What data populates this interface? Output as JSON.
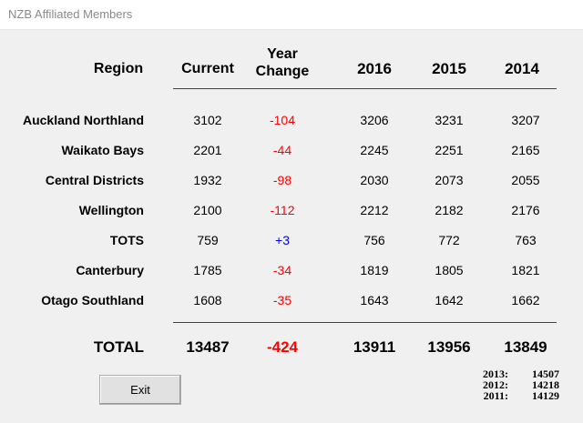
{
  "window": {
    "title": "NZB Affiliated Members"
  },
  "headers": {
    "region": "Region",
    "current": "Current",
    "year_change_line1": "Year",
    "year_change_line2": "Change",
    "y2016": "2016",
    "y2015": "2015",
    "y2014": "2014"
  },
  "rows": [
    {
      "region": "Auckland Northland",
      "current": "3102",
      "change": "-104",
      "y2016": "3206",
      "y2015": "3231",
      "y2014": "3207",
      "change_sign": "negative"
    },
    {
      "region": "Waikato Bays",
      "current": "2201",
      "change": "-44",
      "y2016": "2245",
      "y2015": "2251",
      "y2014": "2165",
      "change_sign": "negative"
    },
    {
      "region": "Central Districts",
      "current": "1932",
      "change": "-98",
      "y2016": "2030",
      "y2015": "2073",
      "y2014": "2055",
      "change_sign": "negative"
    },
    {
      "region": "Wellington",
      "current": "2100",
      "change": "-112",
      "y2016": "2212",
      "y2015": "2182",
      "y2014": "2176",
      "change_sign": "negative"
    },
    {
      "region": "TOTS",
      "current": "759",
      "change": "+3",
      "y2016": "756",
      "y2015": "772",
      "y2014": "763",
      "change_sign": "positive"
    },
    {
      "region": "Canterbury",
      "current": "1785",
      "change": "-34",
      "y2016": "1819",
      "y2015": "1805",
      "y2014": "1821",
      "change_sign": "negative"
    },
    {
      "region": "Otago Southland",
      "current": "1608",
      "change": "-35",
      "y2016": "1643",
      "y2015": "1642",
      "y2014": "1662",
      "change_sign": "negative"
    }
  ],
  "total": {
    "label": "TOTAL",
    "current": "13487",
    "change": "-424",
    "y2016": "13911",
    "y2015": "13956",
    "y2014": "13849"
  },
  "history": [
    {
      "year": "2013:",
      "value": "14507"
    },
    {
      "year": "2012:",
      "value": "14218"
    },
    {
      "year": "2011:",
      "value": "14129"
    }
  ],
  "buttons": {
    "exit": "Exit"
  },
  "colors": {
    "negative": "#ff0000",
    "positive": "#0000ee"
  }
}
